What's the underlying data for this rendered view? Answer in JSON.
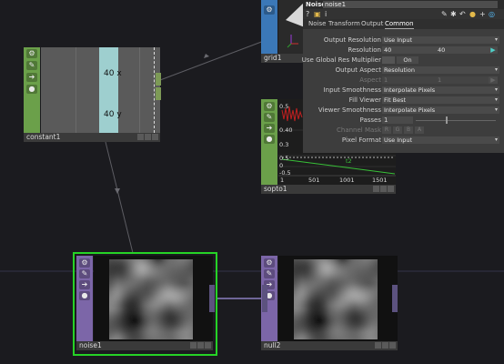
{
  "nodes": {
    "constant": {
      "name": "constant1",
      "values": [
        "40 x",
        "40 y"
      ],
      "icons": [
        "gear-icon",
        "pencil-icon",
        "arrow-right-icon",
        "lock-icon"
      ]
    },
    "grid": {
      "name": "grid1"
    },
    "sopto": {
      "name": "sopto1",
      "graph_ticks_y": [
        "0.5",
        "0.40",
        "0.3",
        "0.5",
        "0",
        "-0.5"
      ],
      "graph_ticks_x": [
        "1",
        "501",
        "1001",
        "1501"
      ],
      "graph_label": "t2"
    },
    "noise": {
      "name": "noise1"
    },
    "null": {
      "name": "null2"
    }
  },
  "panel": {
    "op_type": "Noise",
    "op_name": "noise1",
    "tabs": [
      "Noise",
      "Transform",
      "Output",
      "Common"
    ],
    "active_tab": "Common",
    "params": {
      "output_resolution": {
        "label": "Output Resolution",
        "value": "Use Input"
      },
      "resolution": {
        "label": "Resolution",
        "x": "40",
        "y": "40"
      },
      "global_res": {
        "label": "Use Global Res Multiplier",
        "value": "On"
      },
      "output_aspect": {
        "label": "Output Aspect",
        "value": "Resolution"
      },
      "aspect": {
        "label": "Aspect",
        "x": "1",
        "y": "1"
      },
      "input_smoothness": {
        "label": "Input Smoothness",
        "value": "Interpolate Pixels"
      },
      "fill_viewer": {
        "label": "Fill Viewer",
        "value": "Fit Best"
      },
      "viewer_smoothness": {
        "label": "Viewer Smoothness",
        "value": "Interpolate Pixels"
      },
      "passes": {
        "label": "Passes",
        "value": "1"
      },
      "channel_mask": {
        "label": "Channel Mask",
        "channels": [
          "R",
          "G",
          "B",
          "A"
        ]
      },
      "pixel_format": {
        "label": "Pixel Format",
        "value": "Use Input"
      }
    }
  },
  "colors": {
    "chop": "#6ba04a",
    "top": "#7c66a8",
    "sop": "#3b78b8",
    "selected": "#26d326",
    "background": "#1b1b1f"
  }
}
